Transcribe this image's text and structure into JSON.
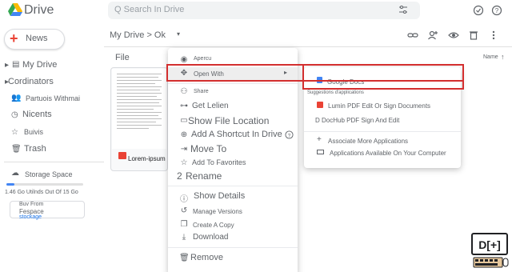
{
  "header": {
    "app_name": "Drive",
    "search_placeholder": "Q Search In Drive"
  },
  "sidebar": {
    "new_label": "News",
    "items": [
      {
        "label": "My Drive"
      },
      {
        "label": "Cordinators"
      },
      {
        "label": "Partuois Withmai"
      },
      {
        "label": "Nicents"
      },
      {
        "label": "Buivis"
      },
      {
        "label": "Trash"
      }
    ],
    "storage_label": "Storage Space",
    "storage_used_text": "1.46 Go Utilnds Out Of 15 Go",
    "storage_fraction": 0.1,
    "buy_line1": "Buv From",
    "buy_line2": "Fespace",
    "buy_link": "stockage"
  },
  "toolbar": {
    "path": "My Drive > Ok"
  },
  "files": {
    "section_label": "File",
    "sort_label": "Name",
    "file_name": "Lorem-ipsum"
  },
  "context_menu": {
    "items": [
      {
        "label": "Apercu",
        "icon": "eye-icon"
      },
      {
        "label": "Open With",
        "icon": "move-icon",
        "has_submenu": true
      },
      {
        "label": "Share",
        "icon": "person-add-icon"
      },
      {
        "label": "Get Lelien",
        "icon": "link-icon"
      },
      {
        "label": "Show File Location",
        "icon": "folder-icon"
      },
      {
        "label": "Add A Shortcut In Drive",
        "icon": "shortcut-icon"
      },
      {
        "label": "Move To",
        "icon": "move-to-icon"
      },
      {
        "label": "Add To Favorites",
        "icon": "star-icon"
      },
      {
        "label": "Rename",
        "icon": "rename-icon"
      },
      {
        "label": "Show Details",
        "icon": "info-icon"
      },
      {
        "label": "Manage Versions",
        "icon": "history-icon"
      },
      {
        "label": "Create A Copy",
        "icon": "copy-icon"
      },
      {
        "label": "Download",
        "icon": "download-icon"
      },
      {
        "label": "Remove",
        "icon": "trash-icon"
      }
    ],
    "rename_number": "2"
  },
  "submenu": {
    "google_docs": "Google Docs",
    "suggestions_header": "Suggestions d'applications",
    "app1": "Lumin PDF Edit Or Sign Documents",
    "app2": "D DocHub PDF Sign And Edit",
    "associate": "Associate More Applications",
    "computer": "Applications Available On Your Computer"
  },
  "colors": {
    "highlight_box": "#d32f2f",
    "accent": "#4285f4",
    "pdf_red": "#ea4335"
  }
}
